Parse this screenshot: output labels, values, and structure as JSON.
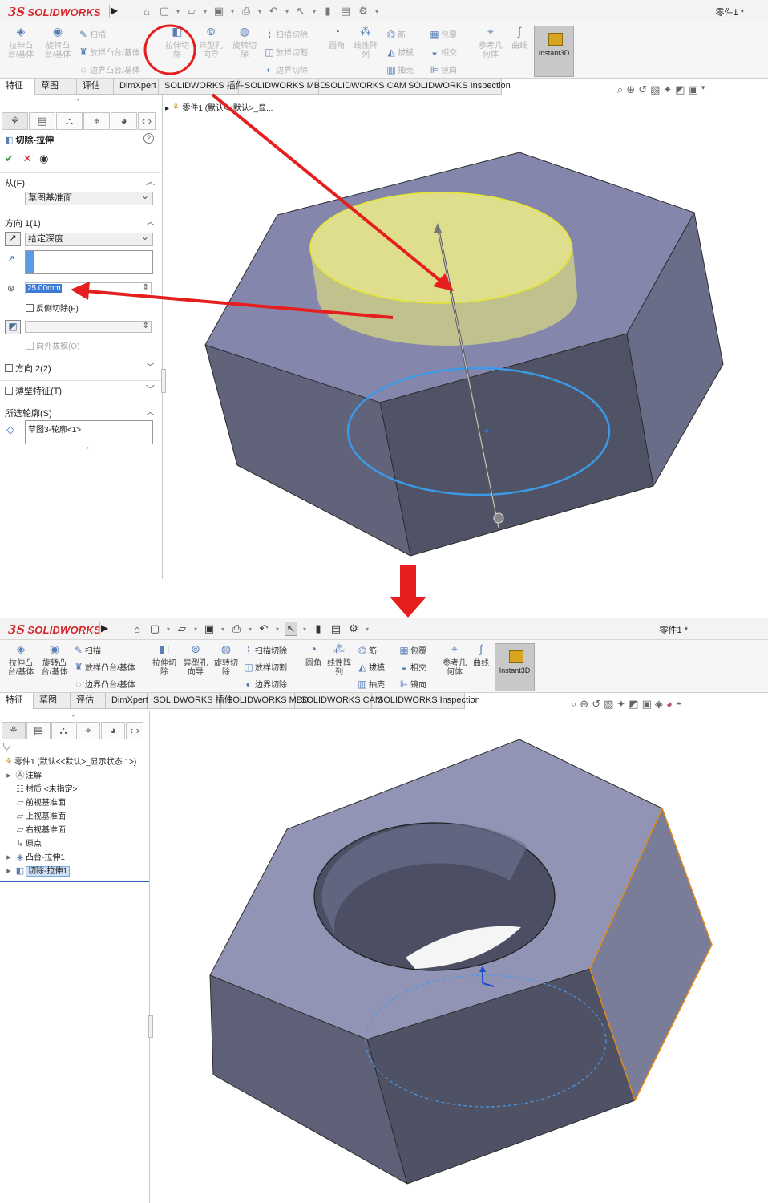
{
  "app": {
    "logo_ds": "3S",
    "logo_text": "SOLIDWORKS",
    "doc_title": "零件1 *"
  },
  "ribbon": {
    "extrude_boss": "拉伸凸\n台/基体",
    "revolve_boss": "旋转凸\n台/基体",
    "sweep": "扫描",
    "loft_boss": "放样凸台/基体",
    "boundary_boss": "边界凸台/基体",
    "extrude_cut": "拉伸切\n除",
    "hole_wizard": "异型孔\n向导",
    "revolve_cut": "旋转切\n除",
    "swept_cut": "扫描切除",
    "lofted_cut": "放样切割",
    "boundary_cut": "边界切除",
    "fillet": "圆角",
    "linear_pattern": "线性阵\n列",
    "rib": "筋",
    "draft": "拔模",
    "shell": "抽壳",
    "wrap": "包覆",
    "intersect": "相交",
    "mirror": "镜向",
    "ref_geometry": "参考几\n何体",
    "curves": "曲线",
    "instant3d": "Instant3D"
  },
  "tabs_top": [
    "特征",
    "草图",
    "评估",
    "DimXpert",
    "SOLIDWORKS 插件",
    "SOLIDWORKS MBD",
    "SOLIDWORKS CAM",
    "SOLIDWORKS Inspection"
  ],
  "tabs_bottom": [
    "特征",
    "草图",
    "评估",
    "DimXpert",
    "SOLIDWORKS 插件",
    "SOLIDWORKS MBD",
    "SOLIDWORKS CAM",
    "SOLIDWORKS Inspection"
  ],
  "breadcrumb": "零件1  (默认<<默认>_显...",
  "property_manager": {
    "title": "切除-拉伸",
    "from_label": "从(F)",
    "from_value": "草图基准面",
    "dir1_label": "方向 1(1)",
    "end_condition": "给定深度",
    "depth": "25.00mm",
    "flip_side": "反侧切除(F)",
    "draft_outward": "向外拔模(O)",
    "dir2_label": "方向 2(2)",
    "thin_label": "薄壁特征(T)",
    "contours_label": "所选轮廓(S)",
    "contour_item": "草图3-轮廓<1>"
  },
  "feature_tree": {
    "root": "零件1  (默认<<默认>_显示状态 1>)",
    "items": [
      "注解",
      "材质 <未指定>",
      "前视基准面",
      "上视基准面",
      "右视基准面",
      "原点",
      "凸台-拉伸1",
      "切除-拉伸1"
    ]
  },
  "colors": {
    "brand": "#d6262b",
    "annotation": "#e61e1e",
    "preview": "#d7d77a",
    "profile": "#3b9ae8",
    "body_top": "#7f83a8",
    "body_side": "#5b5e75"
  }
}
